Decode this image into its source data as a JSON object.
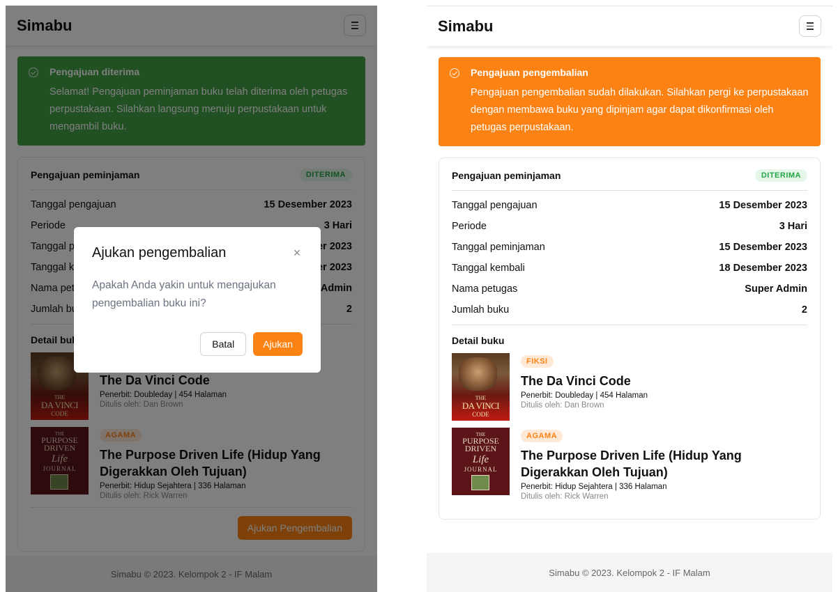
{
  "app": {
    "brand": "Simabu"
  },
  "left": {
    "alert": {
      "title": "Pengajuan diterima",
      "body": "Selamat! Pengajuan peminjaman buku telah diterima oleh petugas perpustakaan. Silahkan langsung menuju perpustakaan untuk mengambil buku."
    },
    "action_button": "Ajukan Pengembalian",
    "modal": {
      "title": "Ajukan pengembalian",
      "close": "×",
      "body": "Apakah Anda yakin untuk mengajukan pengembalian buku ini?",
      "cancel": "Batal",
      "confirm": "Ajukan"
    }
  },
  "right": {
    "alert": {
      "title": "Pengajuan pengembalian",
      "body": "Pengajuan pengembalian sudah dilakukan. Silahkan pergi ke perpustakaan dengan membawa buku yang dipinjam agar dapat dikonfirmasi oleh petugas perpustakaan."
    }
  },
  "loan": {
    "title": "Pengajuan peminjaman",
    "status": "DITERIMA",
    "rows": [
      {
        "label": "Tanggal pengajuan",
        "value": "15 Desember 2023"
      },
      {
        "label": "Periode",
        "value": "3 Hari"
      },
      {
        "label": "Tanggal peminjaman",
        "value": "15 Desember 2023"
      },
      {
        "label": "Tanggal kembali",
        "value": "18 Desember 2023"
      },
      {
        "label": "Nama petugas",
        "value": "Super Admin"
      },
      {
        "label": "Jumlah buku",
        "value": "2"
      }
    ],
    "detail_title": "Detail buku",
    "books": [
      {
        "category": "FIKSI",
        "title": "The Da Vinci Code",
        "publisher": "Penerbit: Doubleday | 454 Halaman",
        "author": "Ditulis oleh: Dan Brown",
        "cover": {
          "t1": "THE",
          "t2": "DA VINCI",
          "t3": "CODE"
        }
      },
      {
        "category": "AGAMA",
        "title": "The Purpose Driven Life (Hidup Yang Digerakkan Oleh Tujuan)",
        "publisher": "Penerbit: Hidup Sejahtera | 336 Halaman",
        "author": "Ditulis oleh: Rick Warren",
        "cover": {
          "p1": "THE",
          "p2": "PURPOSE DRIVEN",
          "p3": "Life",
          "p4": "JOURNAL"
        }
      }
    ]
  },
  "footer": {
    "text": "Simabu © 2023. Kelompok 2 - IF Malam"
  },
  "colors": {
    "orange": "#fd8214",
    "green": "#43a047",
    "badge_green": "#22a745"
  },
  "icons": {
    "menu": "hamburger-menu-icon",
    "alert": "check-circle-icon",
    "close": "close-icon"
  }
}
